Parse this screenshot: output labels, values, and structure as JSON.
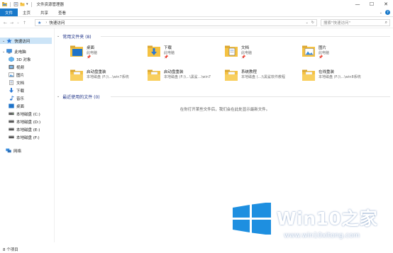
{
  "window": {
    "title": "文件资源管理器",
    "controls": {
      "minimize": "—",
      "maximize": "☐",
      "close": "✕"
    }
  },
  "ribbon": {
    "tabs": [
      "文件",
      "主页",
      "共享",
      "查看"
    ]
  },
  "address": {
    "path": [
      "快速访问"
    ],
    "search_placeholder": "搜索\"快速访问\""
  },
  "nav": {
    "items": [
      {
        "label": "快速访问",
        "icon": "star-icon",
        "selected": true
      },
      {
        "label": "此电脑",
        "icon": "computer-icon"
      },
      {
        "label": "3D 对象",
        "icon": "cube-icon"
      },
      {
        "label": "视频",
        "icon": "video-icon"
      },
      {
        "label": "图片",
        "icon": "pictures-icon"
      },
      {
        "label": "文档",
        "icon": "documents-icon"
      },
      {
        "label": "下载",
        "icon": "download-icon"
      },
      {
        "label": "音乐",
        "icon": "music-icon"
      },
      {
        "label": "桌面",
        "icon": "desktop-icon"
      },
      {
        "label": "本地磁盘 (C:)",
        "icon": "drive-icon"
      },
      {
        "label": "本地磁盘 (D:)",
        "icon": "drive-icon"
      },
      {
        "label": "本地磁盘 (E:)",
        "icon": "drive-icon"
      },
      {
        "label": "本地磁盘 (F:)",
        "icon": "drive-icon"
      },
      {
        "label": "网络",
        "icon": "network-icon"
      }
    ]
  },
  "frequent": {
    "header": "常用文件夹 (8)",
    "folders": [
      {
        "name": "桌面",
        "location": "此电脑",
        "icon": "desktop-folder-icon"
      },
      {
        "name": "下载",
        "location": "此电脑",
        "icon": "downloads-folder-icon"
      },
      {
        "name": "文档",
        "location": "此电脑",
        "icon": "documents-folder-icon"
      },
      {
        "name": "图片",
        "location": "此电脑",
        "icon": "pictures-folder-icon"
      },
      {
        "name": "启动盘重装",
        "location": "本地磁盘 (F:)\\...\\win7系统",
        "icon": "folder-icon"
      },
      {
        "name": "启动盘重装",
        "location": "本地磁盘 (F:)\\...\\黑鲨...\\win7",
        "icon": "folder-icon"
      },
      {
        "name": "系统教程",
        "location": "本地磁盘 (...)\\黑鲨软件教程",
        "icon": "folder-icon"
      },
      {
        "name": "在线重装",
        "location": "本地磁盘 (F:)\\...\\win8系统",
        "icon": "folder-icon"
      }
    ]
  },
  "recent": {
    "header": "最近使用的文件 (0)",
    "empty_message": "在你打开某些文件后，我们会在此处显示最新文件。"
  },
  "status": {
    "items": "8 个项目"
  },
  "watermark": {
    "brand": "Win10之家",
    "url": "www.win10xitong.com"
  }
}
